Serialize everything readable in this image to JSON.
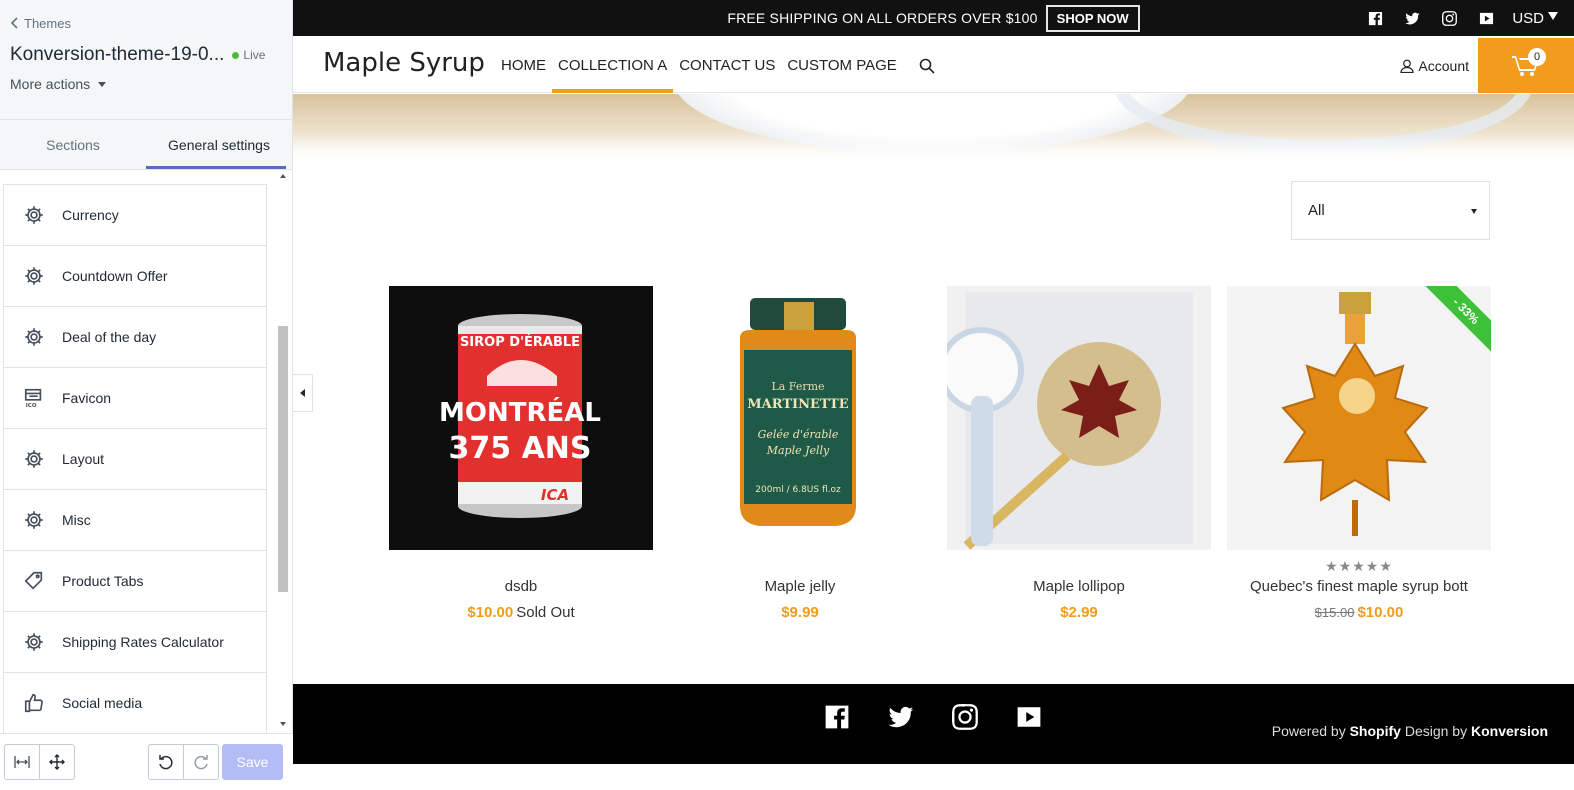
{
  "editor": {
    "back_label": "Themes",
    "theme_name": "Konversion-theme-19-0...",
    "live_label": "Live",
    "more_actions": "More actions",
    "tabs": [
      {
        "label": "Sections"
      },
      {
        "label": "General settings"
      }
    ],
    "settings": [
      {
        "label": "Currency",
        "icon": "gear-icon"
      },
      {
        "label": "Countdown Offer",
        "icon": "gear-icon"
      },
      {
        "label": "Deal of the day",
        "icon": "gear-icon"
      },
      {
        "label": "Favicon",
        "icon": "favicon-icon"
      },
      {
        "label": "Layout",
        "icon": "gear-icon"
      },
      {
        "label": "Misc",
        "icon": "gear-icon"
      },
      {
        "label": "Product Tabs",
        "icon": "tag-icon"
      },
      {
        "label": "Shipping Rates Calculator",
        "icon": "gear-icon"
      },
      {
        "label": "Social media",
        "icon": "thumbs-up-icon"
      }
    ],
    "save_label": "Save"
  },
  "store": {
    "announcement": "FREE SHIPPING ON ALL ORDERS OVER $100",
    "shop_now": "SHOP NOW",
    "currency": "USD",
    "logo": "Maple Syrup",
    "menu": [
      {
        "label": "HOME"
      },
      {
        "label": "COLLECTION A"
      },
      {
        "label": "CONTACT US"
      },
      {
        "label": "CUSTOM PAGE"
      }
    ],
    "account_label": "Account",
    "cart_count": "0",
    "filter_value": "All",
    "accent_color": "#f29b1c",
    "products": [
      {
        "title": "dsdb",
        "price": "$10.00",
        "status": "Sold Out"
      },
      {
        "title": "Maple jelly",
        "price": "$9.99"
      },
      {
        "title": "Maple lollipop",
        "price": "$2.99"
      },
      {
        "title": "Quebec's finest maple syrup bott",
        "compare_price": "$15.00",
        "price": "$10.00",
        "badge": "- 33%",
        "rating": "★★★★★"
      }
    ],
    "footer": {
      "powered_prefix": "Powered by",
      "shopify": "Shopify",
      "design_by": "Design by",
      "konversion": "Konversion"
    }
  }
}
